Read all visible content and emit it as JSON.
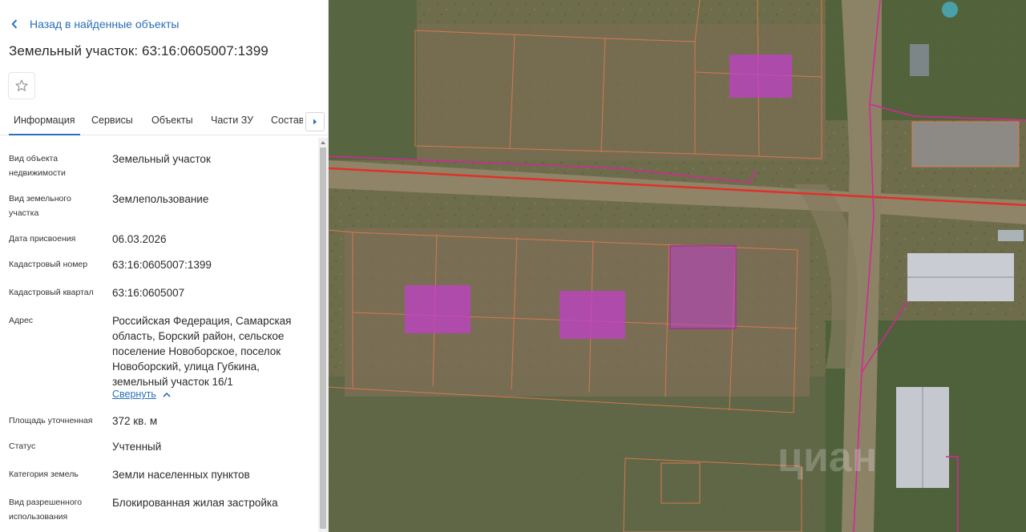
{
  "nav": {
    "back_label": "Назад в найденные объекты"
  },
  "object": {
    "title": "Земельный участок: 63:16:0605007:1399"
  },
  "tabs": [
    {
      "label": "Информация",
      "active": true
    },
    {
      "label": "Сервисы",
      "active": false
    },
    {
      "label": "Объекты",
      "active": false
    },
    {
      "label": "Части ЗУ",
      "active": false
    },
    {
      "label": "Состав",
      "active": false
    }
  ],
  "info": {
    "object_type": {
      "label": "Вид объекта недвижимости",
      "value": "Земельный участок"
    },
    "land_type": {
      "label": "Вид земельного участка",
      "value": "Землепользование"
    },
    "assign_date": {
      "label": "Дата присвоения",
      "value": "06.03.2026"
    },
    "cadastral_num": {
      "label": "Кадастровый номер",
      "value": "63:16:0605007:1399"
    },
    "cadastral_qtr": {
      "label": "Кадастровый квартал",
      "value": "63:16:0605007"
    },
    "address": {
      "label": "Адрес",
      "value": "Российская Федерация, Самарская область, Борский район, сельское поселение Новоборское, поселок Новоборский, улица Губкина, земельный участок 16/1"
    },
    "collapse_label": "Свернуть",
    "area": {
      "label": "Площадь уточненная",
      "value": "372 кв. м"
    },
    "status": {
      "label": "Статус",
      "value": "Учтенный"
    },
    "category": {
      "label": "Категория земель",
      "value": "Земли населенных пунктов"
    },
    "permitted_use": {
      "label": "Вид разрешенного использования",
      "value": "Блокированная жилая застройка"
    }
  },
  "map": {
    "watermark": "циан",
    "colors": {
      "parcel": "#e07a4f",
      "highlight": "#c040c8",
      "road_line": "#e0302a",
      "boundary": "#d8259a"
    }
  }
}
